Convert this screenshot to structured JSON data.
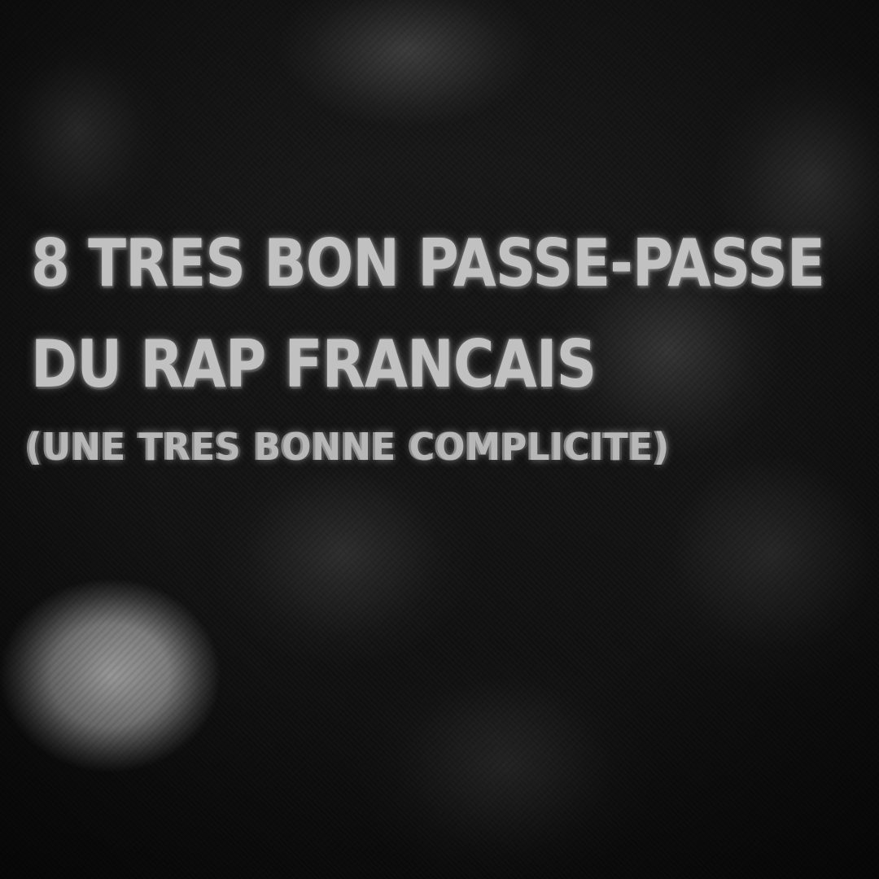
{
  "overlay": {
    "title_line_1": "8 TRES BON PASSE-PASSE",
    "title_line_2": "DU RAP FRANCAIS",
    "subtitle": "(UNE TRES BONNE COMPLICITE)"
  },
  "colors": {
    "title": "#ffbf1a",
    "subtitle": "#ffb214",
    "glow": "#ff8c00"
  }
}
